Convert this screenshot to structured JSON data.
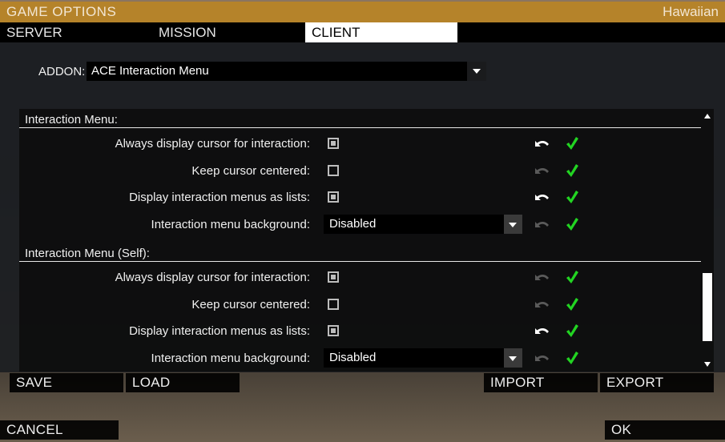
{
  "window": {
    "title": "GAME OPTIONS",
    "user": "Hawaiian"
  },
  "tabs": [
    {
      "label": "SERVER",
      "active": false
    },
    {
      "label": "MISSION",
      "active": false
    },
    {
      "label": "CLIENT",
      "active": true
    }
  ],
  "addon": {
    "label": "ADDON:",
    "value": "ACE Interaction Menu"
  },
  "sections": [
    {
      "title": "Interaction Menu:",
      "settings": [
        {
          "label": "Always display cursor for interaction:",
          "type": "checkbox",
          "checked": true,
          "reset_enabled": true,
          "status": "ok"
        },
        {
          "label": "Keep cursor centered:",
          "type": "checkbox",
          "checked": false,
          "reset_enabled": false,
          "status": "ok"
        },
        {
          "label": "Display interaction menus as lists:",
          "type": "checkbox",
          "checked": true,
          "reset_enabled": true,
          "status": "ok"
        },
        {
          "label": "Interaction menu background:",
          "type": "combo",
          "value": "Disabled",
          "reset_enabled": false,
          "status": "ok"
        }
      ]
    },
    {
      "title": "Interaction Menu (Self):",
      "settings": [
        {
          "label": "Always display cursor for interaction:",
          "type": "checkbox",
          "checked": true,
          "reset_enabled": false,
          "status": "ok"
        },
        {
          "label": "Keep cursor centered:",
          "type": "checkbox",
          "checked": false,
          "reset_enabled": false,
          "status": "ok"
        },
        {
          "label": "Display interaction menus as lists:",
          "type": "checkbox",
          "checked": true,
          "reset_enabled": true,
          "status": "ok"
        },
        {
          "label": "Interaction menu background:",
          "type": "combo",
          "value": "Disabled",
          "reset_enabled": false,
          "status": "ok"
        }
      ]
    }
  ],
  "colors": {
    "title_bar": "#b5832a",
    "ok_check": "#22d422",
    "reset_active": "#ffffff",
    "reset_inactive": "#5a5a5a"
  },
  "buttons": {
    "save": "SAVE",
    "load": "LOAD",
    "import": "IMPORT",
    "export": "EXPORT",
    "cancel": "CANCEL",
    "ok": "OK"
  },
  "icons": {
    "reset": "undo-arrow-icon",
    "status": "checkmark-icon",
    "dropdown": "triangle-down-icon"
  }
}
